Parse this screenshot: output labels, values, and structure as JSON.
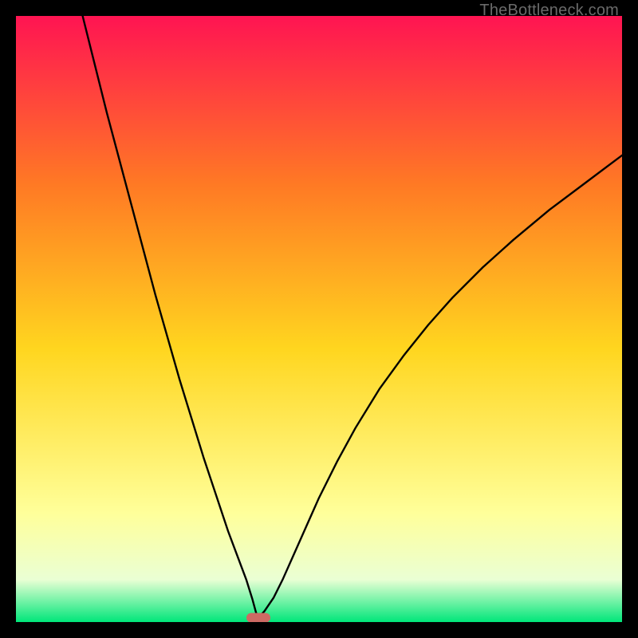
{
  "watermark": "TheBottleneck.com",
  "colors": {
    "gradient_top": "#ff1452",
    "gradient_upper_mid": "#ff7a24",
    "gradient_mid": "#ffd61f",
    "gradient_lower_mid": "#ffff9a",
    "gradient_near_bottom": "#eaffd4",
    "gradient_bottom": "#00e67a",
    "curve": "#000000",
    "marker": "#cd6a63"
  },
  "chart_data": {
    "type": "line",
    "title": "",
    "xlabel": "",
    "ylabel": "",
    "xlim": [
      0,
      100
    ],
    "ylim": [
      0,
      100
    ],
    "marker": {
      "x": 40,
      "y": 0.7
    },
    "series": [
      {
        "name": "left-branch",
        "x": [
          11.0,
          13.0,
          15.0,
          17.0,
          19.0,
          21.0,
          23.0,
          25.0,
          27.0,
          29.0,
          31.0,
          33.0,
          35.0,
          36.5,
          38.0,
          39.0,
          39.6,
          40.0
        ],
        "y": [
          100.0,
          92.0,
          84.0,
          76.5,
          69.0,
          61.5,
          54.0,
          47.0,
          40.0,
          33.5,
          27.0,
          21.0,
          15.0,
          11.0,
          7.0,
          3.8,
          1.6,
          0.7
        ]
      },
      {
        "name": "right-branch",
        "x": [
          40.0,
          41.0,
          42.5,
          44.0,
          46.0,
          48.0,
          50.0,
          53.0,
          56.0,
          60.0,
          64.0,
          68.0,
          72.0,
          77.0,
          82.0,
          88.0,
          94.0,
          100.0
        ],
        "y": [
          0.7,
          1.8,
          4.0,
          7.0,
          11.5,
          16.0,
          20.5,
          26.5,
          32.0,
          38.5,
          44.0,
          49.0,
          53.5,
          58.5,
          63.0,
          68.0,
          72.5,
          77.0
        ]
      }
    ]
  }
}
